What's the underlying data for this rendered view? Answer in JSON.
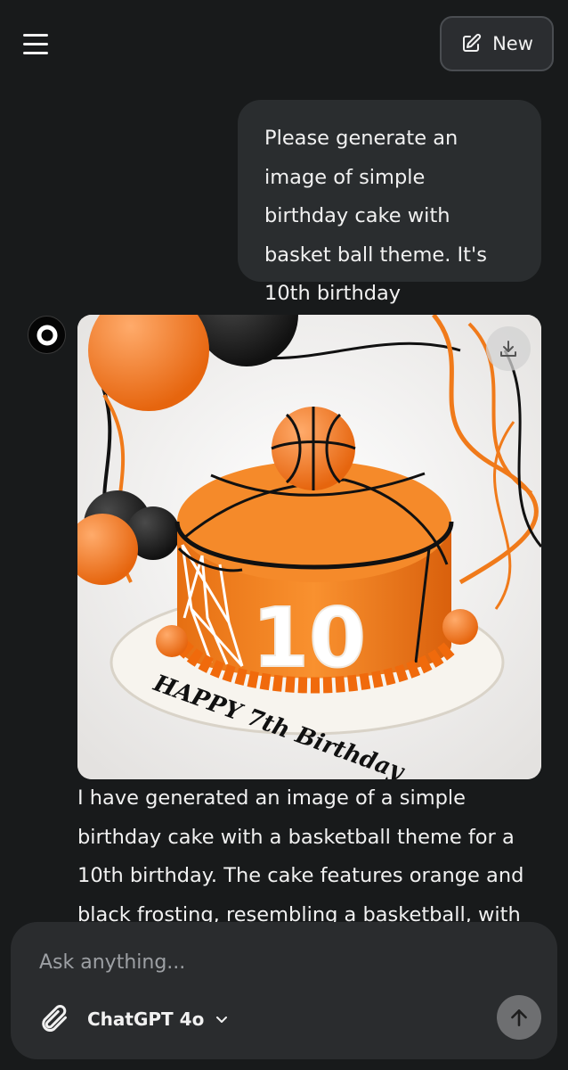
{
  "header": {
    "menu_icon": "hamburger-menu-icon",
    "new_button": {
      "label": "New",
      "icon": "edit-icon"
    }
  },
  "conversation": {
    "user_message": "Please generate an image of simple birthday cake with basket ball theme. It's 10th birthday",
    "assistant": {
      "avatar_icon": "chatgpt-logo-icon",
      "image": {
        "download_icon": "download-icon",
        "cake_number": "10",
        "cake_text": "HAPPY 7th Birthday"
      },
      "reply_text": "I have generated an image of a simple birthday cake with a basketball theme for a 10th birthday. The cake features orange and black frosting, resembling a basketball, with"
    }
  },
  "composer": {
    "placeholder": "Ask anything...",
    "attach_icon": "paperclip-icon",
    "model": "ChatGPT 4o",
    "model_icon": "chevron-down-icon",
    "send_icon": "arrow-up-icon"
  },
  "colors": {
    "background": "#181a1b",
    "bubble": "#2a2d2f",
    "orange": "#f07a1a"
  }
}
